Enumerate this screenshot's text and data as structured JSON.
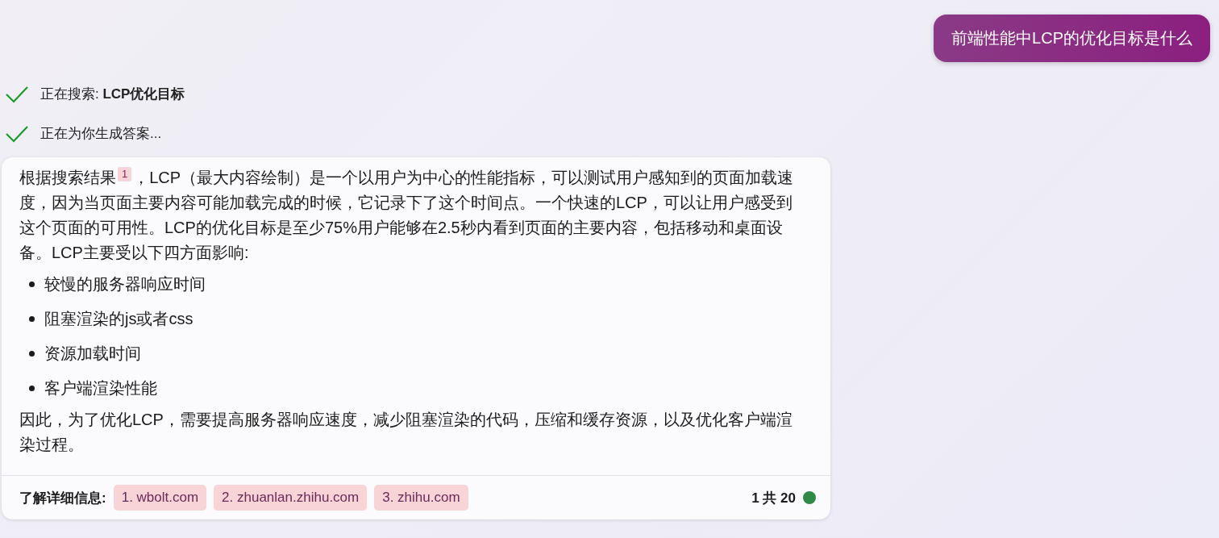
{
  "user_message": "前端性能中LCP的优化目标是什么",
  "steps": [
    {
      "text": "正在搜索: **LCP优化目标**",
      "done": true
    },
    {
      "text": "正在为你生成答案...",
      "done": true
    }
  ],
  "answer": {
    "intro": {
      "before": "根据搜索结果",
      "citation": "1",
      "after": "，LCP（最大内容绘制）是一个以用户为中心的性能指标，可以测试用户感知到的页面加载速度，因为当页面主要内容可能加载完成的时候，它记录下了这个时间点。一个快速的LCP，可以让用户感受到这个页面的可用性。LCP的优化目标是至少75%用户能够在2.5秒内看到页面的主要内容，包括移动和桌面设备。LCP主要受以下四方面影响:"
    },
    "bullets": [
      "较慢的服务器响应时间",
      "阻塞渲染的js或者css",
      "资源加载时间",
      "客户端渲染性能"
    ],
    "conclusion": "因此，为了优化LCP，需要提高服务器响应速度，减少阻塞渲染的代码，压缩和缓存资源，以及优化客户端渲染过程。",
    "sources_label": "了解详细信息:",
    "sources": [
      "1. wbolt.com",
      "2. zhuanlan.zhihu.com",
      "3. zhihu.com"
    ],
    "count": "1 共 20"
  }
}
